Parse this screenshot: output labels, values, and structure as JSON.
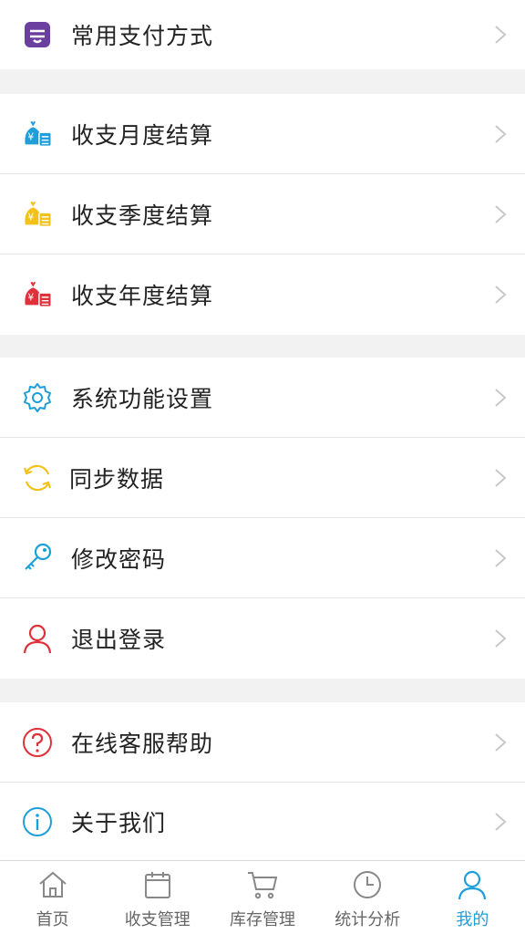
{
  "menu": {
    "payment": "常用支付方式",
    "monthly": "收支月度结算",
    "quarterly": "收支季度结算",
    "yearly": "收支年度结算",
    "settings": "系统功能设置",
    "sync": "同步数据",
    "password": "修改密码",
    "logout": "退出登录",
    "support": "在线客服帮助",
    "about": "关于我们"
  },
  "tabs": [
    {
      "label": "首页",
      "icon": "home-icon"
    },
    {
      "label": "收支管理",
      "icon": "calendar-icon"
    },
    {
      "label": "库存管理",
      "icon": "cart-icon"
    },
    {
      "label": "统计分析",
      "icon": "clock-icon"
    },
    {
      "label": "我的",
      "icon": "user-icon",
      "active": true
    }
  ],
  "colors": {
    "accent": "#1E9FD9",
    "purple": "#6B3FA0",
    "yellow": "#F2C21B",
    "red": "#E0303A"
  }
}
